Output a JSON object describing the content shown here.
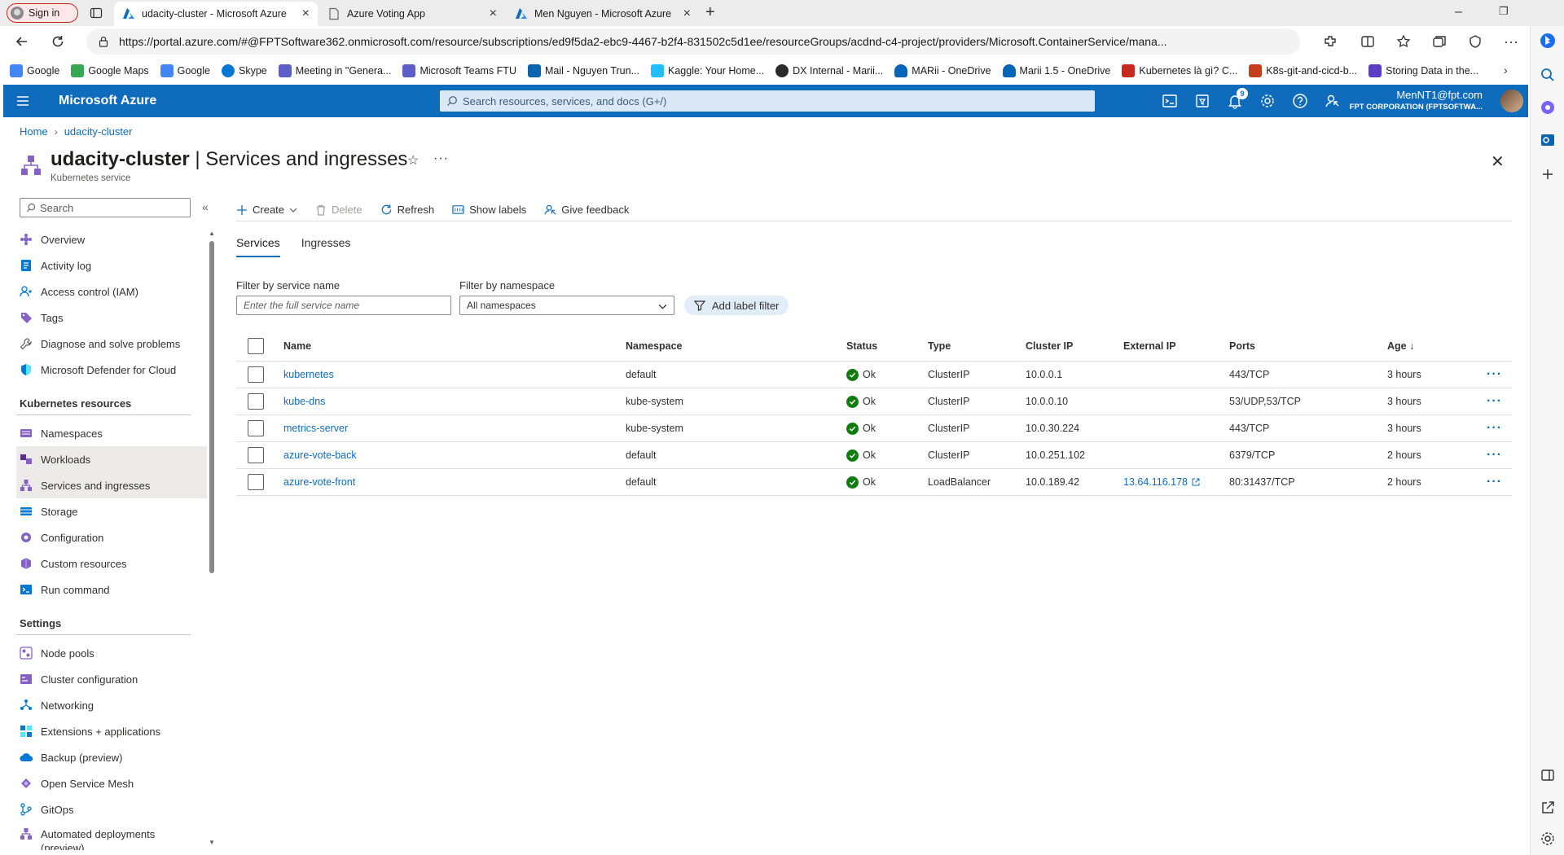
{
  "browser": {
    "signin_label": "Sign in",
    "tabs": [
      {
        "title": "udacity-cluster - Microsoft Azure",
        "active": true
      },
      {
        "title": "Azure Voting App",
        "active": false
      },
      {
        "title": "Men Nguyen - Microsoft Azure",
        "active": false
      }
    ],
    "new_tab_label": "+",
    "url": "https://portal.azure.com/#@FPTSoftware362.onmicrosoft.com/resource/subscriptions/ed9f5da2-ebc9-4467-b2f4-831502c5d1ee/resourceGroups/acdnd-c4-project/providers/Microsoft.ContainerService/mana...",
    "favorites": [
      {
        "label": "Google",
        "color": "#4285f4"
      },
      {
        "label": "Google Maps",
        "color": "#34a853"
      },
      {
        "label": "Google",
        "color": "#4285f4"
      },
      {
        "label": "Skype",
        "color": "#0078d4"
      },
      {
        "label": "Meeting in \"Genera...",
        "color": "#5b5fc7"
      },
      {
        "label": "Microsoft Teams FTU",
        "color": "#5b5fc7"
      },
      {
        "label": "Mail - Nguyen Trun...",
        "color": "#0a64ad"
      },
      {
        "label": "Kaggle: Your Home...",
        "color": "#20beff"
      },
      {
        "label": "DX Internal - Marii...",
        "color": "#2b2b2b"
      },
      {
        "label": "MARii - OneDrive",
        "color": "#0364b8"
      },
      {
        "label": "Marii 1.5 - OneDrive",
        "color": "#0364b8"
      },
      {
        "label": "Kubernetes là gì? C...",
        "color": "#c42b1c"
      },
      {
        "label": "K8s-git-and-cicd-b...",
        "color": "#c43e1c"
      },
      {
        "label": "Storing Data in the...",
        "color": "#5b3cc4"
      }
    ]
  },
  "azure": {
    "brand": "Microsoft Azure",
    "search_placeholder": "Search resources, services, and docs (G+/)",
    "notification_count": "9",
    "user_email": "MenNT1@fpt.com",
    "user_org": "FPT CORPORATION (FPTSOFTWA..."
  },
  "breadcrumb": {
    "home": "Home",
    "current": "udacity-cluster"
  },
  "header": {
    "resource_name": "udacity-cluster",
    "separator": " | ",
    "page_name": "Services and ingresses",
    "subtitle": "Kubernetes service"
  },
  "nav": {
    "search_placeholder": "Search",
    "items": [
      {
        "label": "Overview",
        "icon": "overview-icon",
        "color": "#8661c5"
      },
      {
        "label": "Activity log",
        "icon": "activity-log-icon",
        "color": "#0078d4"
      },
      {
        "label": "Access control (IAM)",
        "icon": "iam-icon",
        "color": "#0078d4"
      },
      {
        "label": "Tags",
        "icon": "tag-icon",
        "color": "#8661c5"
      },
      {
        "label": "Diagnose and solve problems",
        "icon": "wrench-icon",
        "color": "#605e5c"
      },
      {
        "label": "Microsoft Defender for Cloud",
        "icon": "shield-icon",
        "color": "#0078d4"
      }
    ],
    "section_k8s": "Kubernetes resources",
    "k8s_items": [
      {
        "label": "Namespaces",
        "icon": "namespaces-icon",
        "color": "#8661c5",
        "selected": false
      },
      {
        "label": "Workloads",
        "icon": "workloads-icon",
        "color": "#5c2d91",
        "selected": true
      },
      {
        "label": "Services and ingresses",
        "icon": "services-icon",
        "color": "#8661c5",
        "selected": true
      },
      {
        "label": "Storage",
        "icon": "storage-icon",
        "color": "#0078d4",
        "selected": false
      },
      {
        "label": "Configuration",
        "icon": "configuration-icon",
        "color": "#8661c5",
        "selected": false
      },
      {
        "label": "Custom resources",
        "icon": "custom-resources-icon",
        "color": "#8661c5",
        "selected": false
      },
      {
        "label": "Run command",
        "icon": "run-command-icon",
        "color": "#0078d4",
        "selected": false
      }
    ],
    "section_settings": "Settings",
    "settings_items": [
      {
        "label": "Node pools",
        "icon": "node-pools-icon",
        "color": "#8661c5"
      },
      {
        "label": "Cluster configuration",
        "icon": "cluster-config-icon",
        "color": "#8661c5"
      },
      {
        "label": "Networking",
        "icon": "networking-icon",
        "color": "#0078d4"
      },
      {
        "label": "Extensions + applications",
        "icon": "extensions-icon",
        "color": "#0078d4"
      },
      {
        "label": "Backup (preview)",
        "icon": "backup-icon",
        "color": "#0078d4"
      },
      {
        "label": "Open Service Mesh",
        "icon": "service-mesh-icon",
        "color": "#8661c5"
      },
      {
        "label": "GitOps",
        "icon": "gitops-icon",
        "color": "#0078d4"
      },
      {
        "label": "Automated deployments (preview)",
        "icon": "deployments-icon",
        "color": "#8661c5"
      }
    ]
  },
  "toolbar": {
    "create": "Create",
    "delete": "Delete",
    "refresh": "Refresh",
    "show_labels": "Show labels",
    "feedback": "Give feedback"
  },
  "tabs": {
    "services": "Services",
    "ingresses": "Ingresses"
  },
  "filters": {
    "service_label": "Filter by service name",
    "service_placeholder": "Enter the full service name",
    "namespace_label": "Filter by namespace",
    "namespace_value": "All namespaces",
    "label_filter": "Add label filter"
  },
  "table": {
    "headers": {
      "name": "Name",
      "namespace": "Namespace",
      "status": "Status",
      "type": "Type",
      "cluster_ip": "Cluster IP",
      "external_ip": "External IP",
      "ports": "Ports",
      "age": "Age ↓"
    },
    "rows": [
      {
        "name": "kubernetes",
        "namespace": "default",
        "status": "Ok",
        "type": "ClusterIP",
        "cluster_ip": "10.0.0.1",
        "external_ip": "",
        "ports": "443/TCP",
        "age": "3 hours"
      },
      {
        "name": "kube-dns",
        "namespace": "kube-system",
        "status": "Ok",
        "type": "ClusterIP",
        "cluster_ip": "10.0.0.10",
        "external_ip": "",
        "ports": "53/UDP,53/TCP",
        "age": "3 hours"
      },
      {
        "name": "metrics-server",
        "namespace": "kube-system",
        "status": "Ok",
        "type": "ClusterIP",
        "cluster_ip": "10.0.30.224",
        "external_ip": "",
        "ports": "443/TCP",
        "age": "3 hours"
      },
      {
        "name": "azure-vote-back",
        "namespace": "default",
        "status": "Ok",
        "type": "ClusterIP",
        "cluster_ip": "10.0.251.102",
        "external_ip": "",
        "ports": "6379/TCP",
        "age": "2 hours"
      },
      {
        "name": "azure-vote-front",
        "namespace": "default",
        "status": "Ok",
        "type": "LoadBalancer",
        "cluster_ip": "10.0.189.42",
        "external_ip": "13.64.116.178",
        "ports": "80:31437/TCP",
        "age": "2 hours"
      }
    ]
  }
}
